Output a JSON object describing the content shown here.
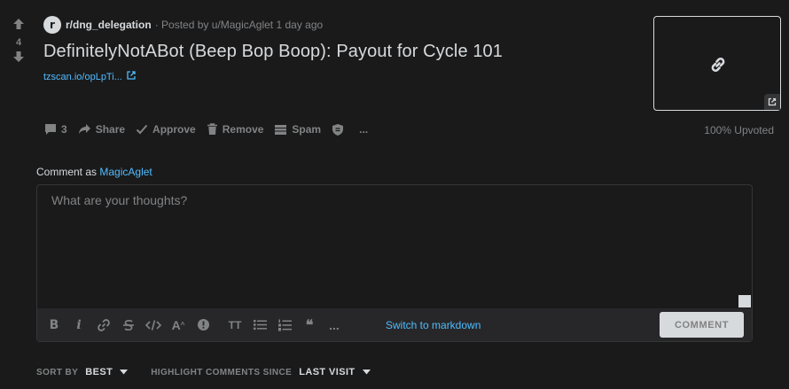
{
  "post": {
    "score": "4",
    "subreddit": "r/dng_delegation",
    "subreddit_icon_letter": "r",
    "separator": "·",
    "posted_by_prefix": "Posted by",
    "author": "u/MagicAglet",
    "time_ago": "1 day ago",
    "title": "DefinitelyNotABot (Beep Bop Boop): Payout for Cycle 101",
    "link_text": "tzscan.io/opLpTi...",
    "upvote_ratio": "100% Upvoted"
  },
  "actions": {
    "comments_count": "3",
    "share": "Share",
    "approve": "Approve",
    "remove": "Remove",
    "spam": "Spam",
    "more": "..."
  },
  "comment_box": {
    "comment_as_prefix": "Comment as",
    "username": "MagicAglet",
    "placeholder": "What are your thoughts?",
    "switch_markdown": "Switch to markdown",
    "submit_label": "COMMENT"
  },
  "toolbar": {
    "bold": "B",
    "italic": "i",
    "superscript": "A",
    "heading": "TT",
    "quote": "❝",
    "more": "..."
  },
  "sort": {
    "sort_by_label": "SORT BY",
    "sort_by_value": "BEST",
    "highlight_label": "HIGHLIGHT COMMENTS SINCE",
    "highlight_value": "LAST VISIT"
  },
  "colors": {
    "background": "#1a1a1b",
    "text": "#d7dadc",
    "muted": "#818384",
    "link": "#4fbcff",
    "toolbar": "#272729"
  }
}
